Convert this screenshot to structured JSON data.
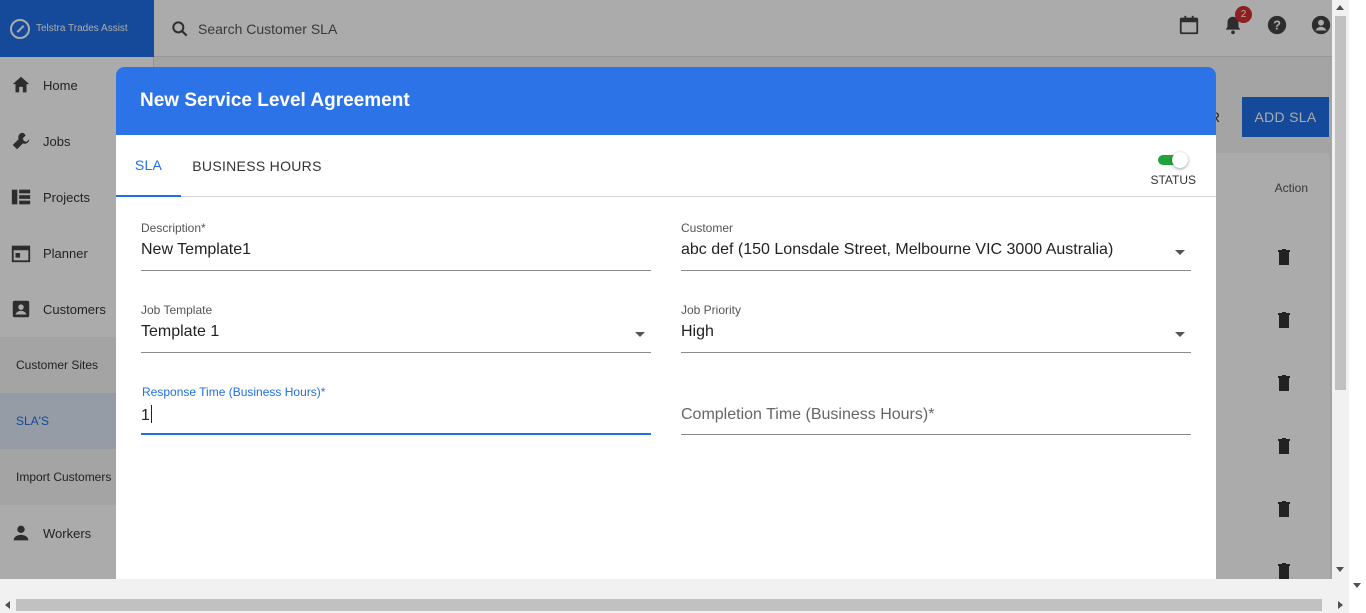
{
  "app": {
    "brand": "Telstra Trades Assist"
  },
  "search": {
    "placeholder": "Search Customer SLA"
  },
  "notifications": {
    "count": "2"
  },
  "sidebar": {
    "items": [
      {
        "label": "Home"
      },
      {
        "label": "Jobs"
      },
      {
        "label": "Projects"
      },
      {
        "label": "Planner"
      },
      {
        "label": "Customers"
      }
    ],
    "subitems": [
      {
        "label": "Customer Sites"
      },
      {
        "label": "SLA'S"
      },
      {
        "label": "Import Customers"
      }
    ],
    "workers": {
      "label": "Workers"
    }
  },
  "page": {
    "add_button": "ADD SLA",
    "ghost_text": "R",
    "action_header": "Action"
  },
  "modal": {
    "title": "New Service Level Agreement",
    "tabs": [
      {
        "label": "SLA"
      },
      {
        "label": "BUSINESS HOURS"
      }
    ],
    "status_label": "STATUS",
    "fields": {
      "description": {
        "label": "Description*",
        "value": "New Template1"
      },
      "customer": {
        "label": "Customer",
        "value": "abc def (150 Lonsdale Street, Melbourne VIC 3000 Australia)"
      },
      "job_template": {
        "label": "Job Template",
        "value": "Template 1"
      },
      "job_priority": {
        "label": "Job Priority",
        "value": "High"
      },
      "response_time": {
        "label": "Response Time (Business Hours)*",
        "value": "1"
      },
      "completion_time": {
        "placeholder": "Completion Time (Business Hours)*"
      }
    }
  },
  "colors": {
    "primary": "#1f6fe5",
    "header": "#2c73e8",
    "status_on": "#22a33a",
    "badge": "#d32f2f"
  }
}
